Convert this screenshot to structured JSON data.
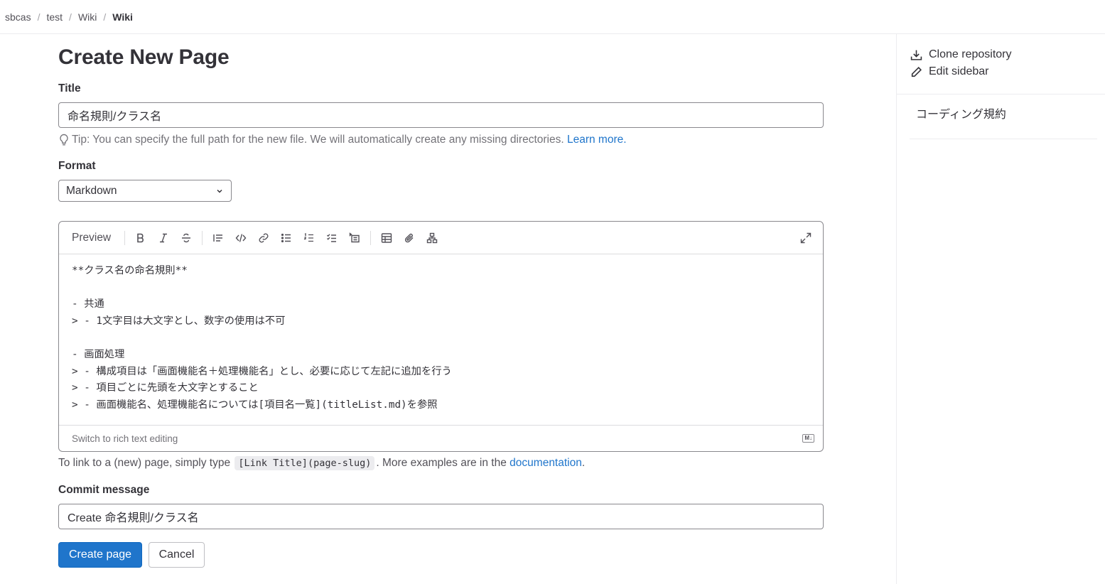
{
  "breadcrumb": {
    "items": [
      "sbcas",
      "test",
      "Wiki"
    ],
    "current": "Wiki"
  },
  "page": {
    "title": "Create New Page"
  },
  "form": {
    "title_label": "Title",
    "title_value": "命名規則/クラス名",
    "tip_text": "Tip: You can specify the full path for the new file. We will automatically create any missing directories.",
    "tip_link": "Learn more.",
    "format_label": "Format",
    "format_value": "Markdown",
    "commit_label": "Commit message",
    "commit_value": "Create 命名規則/クラス名"
  },
  "editor": {
    "preview_label": "Preview",
    "lines": [
      "**クラス名の命名規則**",
      "",
      "- 共通",
      "> - 1文字目は大文字とし、数字の使用は不可",
      "",
      "- 画面処理",
      "> - 構成項目は「画面機能名＋処理機能名」とし、必要に応じて左記に追加を行う",
      "> - 項目ごとに先頭を大文字とすること",
      "> - 画面機能名、処理機能名については[項目名一覧](titleList.md)を参照"
    ],
    "switch_label": "Switch to rich text editing",
    "md_badge": "M↓"
  },
  "help": {
    "prefix": "To link to a (new) page, simply type",
    "code": "[Link Title](page-slug)",
    "middle": ". More examples are in the",
    "link": "documentation",
    "suffix": "."
  },
  "buttons": {
    "create": "Create page",
    "cancel": "Cancel"
  },
  "sidebar": {
    "clone": "Clone repository",
    "edit": "Edit sidebar",
    "pages": [
      "コーディング規約"
    ]
  }
}
